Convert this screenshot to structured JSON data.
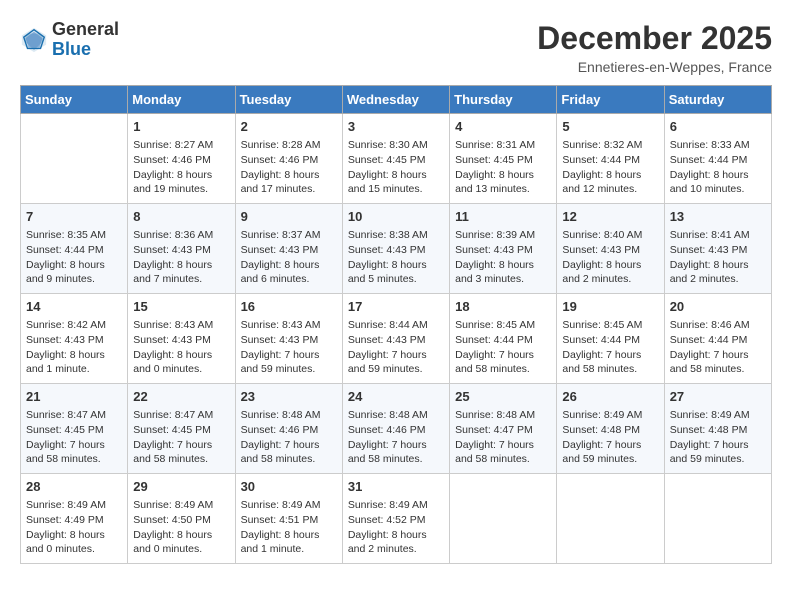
{
  "header": {
    "logo_general": "General",
    "logo_blue": "Blue",
    "month_title": "December 2025",
    "subtitle": "Ennetieres-en-Weppes, France"
  },
  "days_of_week": [
    "Sunday",
    "Monday",
    "Tuesday",
    "Wednesday",
    "Thursday",
    "Friday",
    "Saturday"
  ],
  "weeks": [
    [
      {
        "day": "",
        "content": ""
      },
      {
        "day": "1",
        "content": "Sunrise: 8:27 AM\nSunset: 4:46 PM\nDaylight: 8 hours\nand 19 minutes."
      },
      {
        "day": "2",
        "content": "Sunrise: 8:28 AM\nSunset: 4:46 PM\nDaylight: 8 hours\nand 17 minutes."
      },
      {
        "day": "3",
        "content": "Sunrise: 8:30 AM\nSunset: 4:45 PM\nDaylight: 8 hours\nand 15 minutes."
      },
      {
        "day": "4",
        "content": "Sunrise: 8:31 AM\nSunset: 4:45 PM\nDaylight: 8 hours\nand 13 minutes."
      },
      {
        "day": "5",
        "content": "Sunrise: 8:32 AM\nSunset: 4:44 PM\nDaylight: 8 hours\nand 12 minutes."
      },
      {
        "day": "6",
        "content": "Sunrise: 8:33 AM\nSunset: 4:44 PM\nDaylight: 8 hours\nand 10 minutes."
      }
    ],
    [
      {
        "day": "7",
        "content": "Sunrise: 8:35 AM\nSunset: 4:44 PM\nDaylight: 8 hours\nand 9 minutes."
      },
      {
        "day": "8",
        "content": "Sunrise: 8:36 AM\nSunset: 4:43 PM\nDaylight: 8 hours\nand 7 minutes."
      },
      {
        "day": "9",
        "content": "Sunrise: 8:37 AM\nSunset: 4:43 PM\nDaylight: 8 hours\nand 6 minutes."
      },
      {
        "day": "10",
        "content": "Sunrise: 8:38 AM\nSunset: 4:43 PM\nDaylight: 8 hours\nand 5 minutes."
      },
      {
        "day": "11",
        "content": "Sunrise: 8:39 AM\nSunset: 4:43 PM\nDaylight: 8 hours\nand 3 minutes."
      },
      {
        "day": "12",
        "content": "Sunrise: 8:40 AM\nSunset: 4:43 PM\nDaylight: 8 hours\nand 2 minutes."
      },
      {
        "day": "13",
        "content": "Sunrise: 8:41 AM\nSunset: 4:43 PM\nDaylight: 8 hours\nand 2 minutes."
      }
    ],
    [
      {
        "day": "14",
        "content": "Sunrise: 8:42 AM\nSunset: 4:43 PM\nDaylight: 8 hours\nand 1 minute."
      },
      {
        "day": "15",
        "content": "Sunrise: 8:43 AM\nSunset: 4:43 PM\nDaylight: 8 hours\nand 0 minutes."
      },
      {
        "day": "16",
        "content": "Sunrise: 8:43 AM\nSunset: 4:43 PM\nDaylight: 7 hours\nand 59 minutes."
      },
      {
        "day": "17",
        "content": "Sunrise: 8:44 AM\nSunset: 4:43 PM\nDaylight: 7 hours\nand 59 minutes."
      },
      {
        "day": "18",
        "content": "Sunrise: 8:45 AM\nSunset: 4:44 PM\nDaylight: 7 hours\nand 58 minutes."
      },
      {
        "day": "19",
        "content": "Sunrise: 8:45 AM\nSunset: 4:44 PM\nDaylight: 7 hours\nand 58 minutes."
      },
      {
        "day": "20",
        "content": "Sunrise: 8:46 AM\nSunset: 4:44 PM\nDaylight: 7 hours\nand 58 minutes."
      }
    ],
    [
      {
        "day": "21",
        "content": "Sunrise: 8:47 AM\nSunset: 4:45 PM\nDaylight: 7 hours\nand 58 minutes."
      },
      {
        "day": "22",
        "content": "Sunrise: 8:47 AM\nSunset: 4:45 PM\nDaylight: 7 hours\nand 58 minutes."
      },
      {
        "day": "23",
        "content": "Sunrise: 8:48 AM\nSunset: 4:46 PM\nDaylight: 7 hours\nand 58 minutes."
      },
      {
        "day": "24",
        "content": "Sunrise: 8:48 AM\nSunset: 4:46 PM\nDaylight: 7 hours\nand 58 minutes."
      },
      {
        "day": "25",
        "content": "Sunrise: 8:48 AM\nSunset: 4:47 PM\nDaylight: 7 hours\nand 58 minutes."
      },
      {
        "day": "26",
        "content": "Sunrise: 8:49 AM\nSunset: 4:48 PM\nDaylight: 7 hours\nand 59 minutes."
      },
      {
        "day": "27",
        "content": "Sunrise: 8:49 AM\nSunset: 4:48 PM\nDaylight: 7 hours\nand 59 minutes."
      }
    ],
    [
      {
        "day": "28",
        "content": "Sunrise: 8:49 AM\nSunset: 4:49 PM\nDaylight: 8 hours\nand 0 minutes."
      },
      {
        "day": "29",
        "content": "Sunrise: 8:49 AM\nSunset: 4:50 PM\nDaylight: 8 hours\nand 0 minutes."
      },
      {
        "day": "30",
        "content": "Sunrise: 8:49 AM\nSunset: 4:51 PM\nDaylight: 8 hours\nand 1 minute."
      },
      {
        "day": "31",
        "content": "Sunrise: 8:49 AM\nSunset: 4:52 PM\nDaylight: 8 hours\nand 2 minutes."
      },
      {
        "day": "",
        "content": ""
      },
      {
        "day": "",
        "content": ""
      },
      {
        "day": "",
        "content": ""
      }
    ]
  ]
}
